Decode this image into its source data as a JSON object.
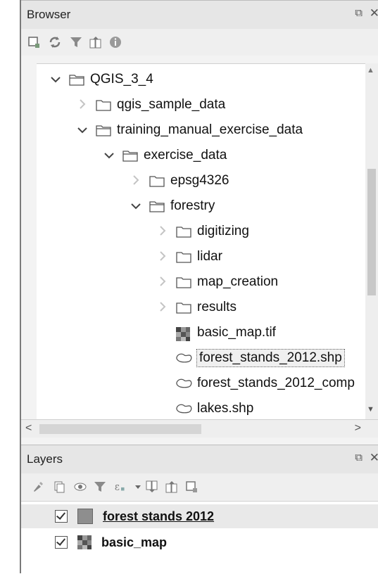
{
  "browser_panel": {
    "title": "Browser",
    "float_glyph": "⧉",
    "close_glyph": "✕",
    "toolbar_icons": [
      "add-selected-layers-icon",
      "refresh-icon",
      "filter-icon",
      "collapse-all-icon",
      "info-icon"
    ],
    "tree": [
      {
        "label": "QGIS_3_4",
        "depth": 0,
        "state": "expanded",
        "icon": "folder-open-icon"
      },
      {
        "label": "qgis_sample_data",
        "depth": 1,
        "state": "collapsed",
        "icon": "folder-icon"
      },
      {
        "label": "training_manual_exercise_data",
        "depth": 1,
        "state": "expanded",
        "icon": "folder-open-icon"
      },
      {
        "label": "exercise_data",
        "depth": 2,
        "state": "expanded",
        "icon": "folder-open-icon"
      },
      {
        "label": "epsg4326",
        "depth": 3,
        "state": "collapsed",
        "icon": "folder-icon"
      },
      {
        "label": "forestry",
        "depth": 3,
        "state": "expanded",
        "icon": "folder-open-icon"
      },
      {
        "label": "digitizing",
        "depth": 4,
        "state": "collapsed",
        "icon": "folder-icon"
      },
      {
        "label": "lidar",
        "depth": 4,
        "state": "collapsed",
        "icon": "folder-icon"
      },
      {
        "label": "map_creation",
        "depth": 4,
        "state": "collapsed",
        "icon": "folder-icon"
      },
      {
        "label": "results",
        "depth": 4,
        "state": "collapsed",
        "icon": "folder-icon"
      },
      {
        "label": "basic_map.tif",
        "depth": 4,
        "state": "leaf",
        "icon": "raster-layer-icon"
      },
      {
        "label": "forest_stands_2012.shp",
        "depth": 4,
        "state": "leaf",
        "icon": "polygon-layer-icon",
        "selected": true
      },
      {
        "label": "forest_stands_2012_comp",
        "depth": 4,
        "state": "leaf",
        "icon": "polygon-layer-icon"
      },
      {
        "label": "lakes.shp",
        "depth": 4,
        "state": "leaf",
        "icon": "polygon-layer-icon"
      }
    ],
    "hscroll_left": "<",
    "hscroll_right": ">"
  },
  "layers_panel": {
    "title": "Layers",
    "float_glyph": "⧉",
    "close_glyph": "✕",
    "toolbar_icons": [
      "style-icon",
      "add-group-icon",
      "manage-visibility-icon",
      "filter-legend-icon",
      "filter-expression-icon",
      "expand-all-icon",
      "collapse-all-icon",
      "remove-layer-icon"
    ],
    "layers": [
      {
        "name": "forest stands 2012",
        "checked": true,
        "icon": "polygon-swatch-icon",
        "active": true
      },
      {
        "name": "basic_map",
        "checked": true,
        "icon": "raster-layer-icon",
        "active": false
      }
    ]
  },
  "colors": {
    "folder_stroke": "#555555",
    "polygon_swatch": "#8e8e8e"
  }
}
